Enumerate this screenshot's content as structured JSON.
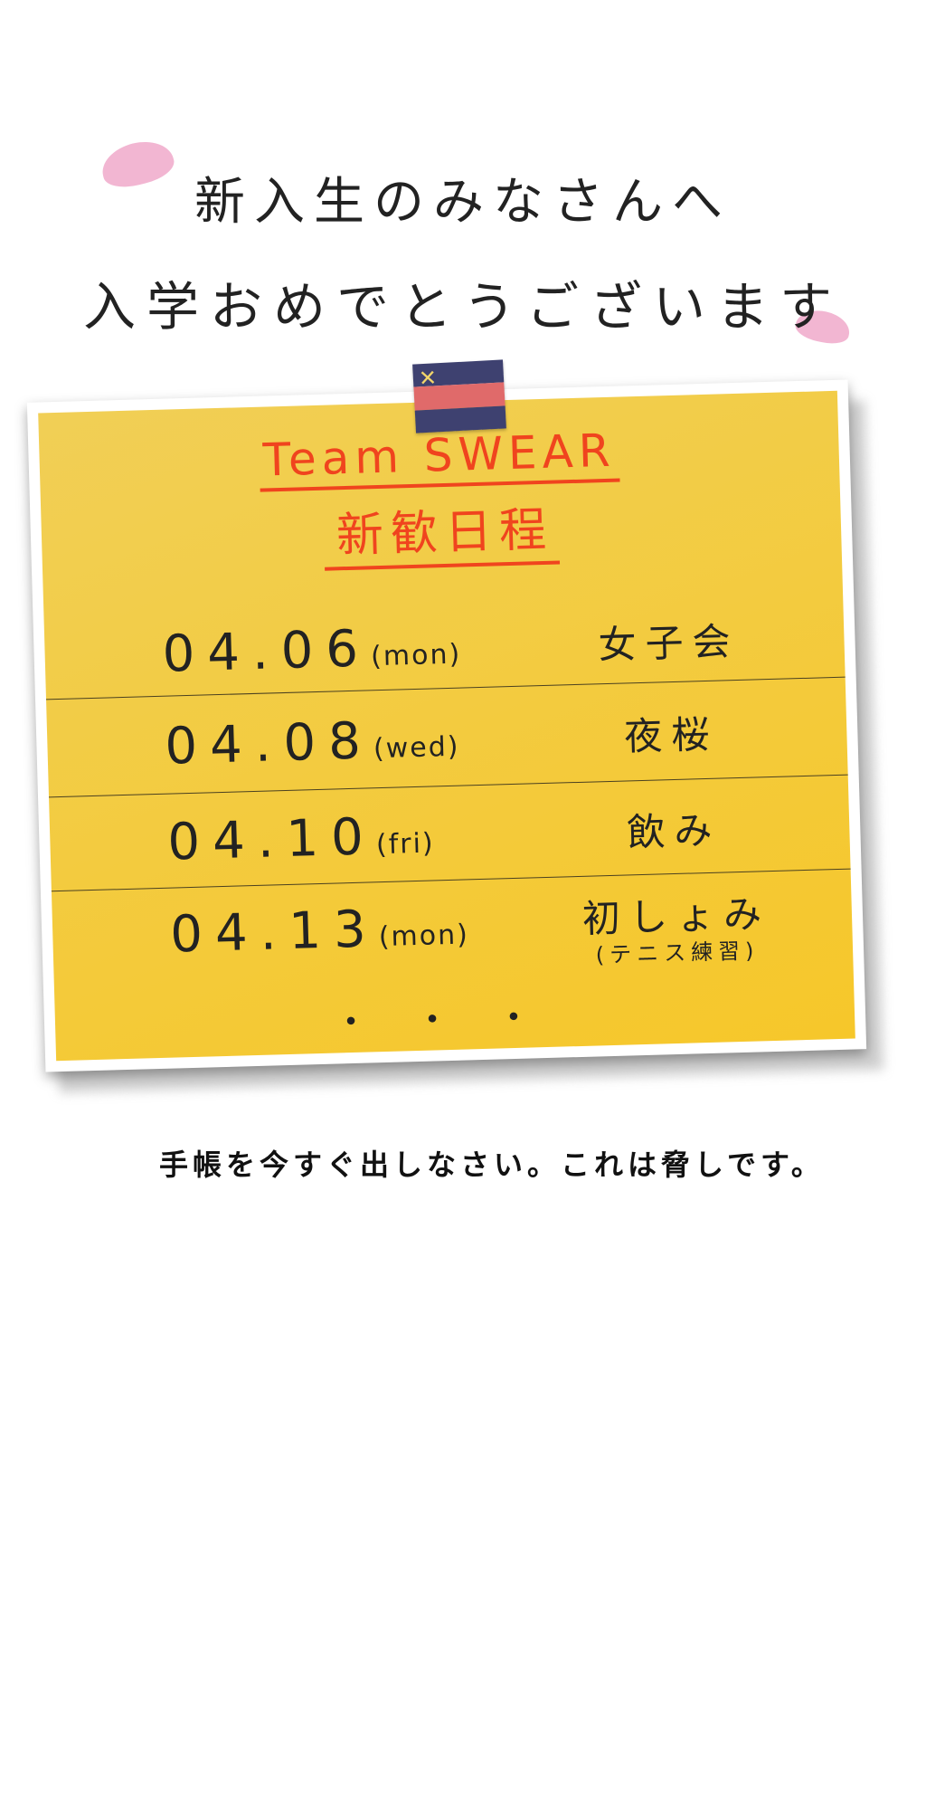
{
  "greeting": {
    "line1": "新入生のみなさんへ",
    "line2": "入学おめでとうございます"
  },
  "note": {
    "title_en": "Team SWEAR",
    "title_ja": "新歓日程",
    "schedule": [
      {
        "date": "04.06",
        "dow": "(mon)",
        "event": "女子会",
        "sub": ""
      },
      {
        "date": "04.08",
        "dow": "(wed)",
        "event": "夜桜",
        "sub": ""
      },
      {
        "date": "04.10",
        "dow": "(fri)",
        "event": "飲み",
        "sub": ""
      },
      {
        "date": "04.13",
        "dow": "(mon)",
        "event": "初しょみ",
        "sub": "(テニス練習)"
      }
    ],
    "ellipsis": "・・・"
  },
  "footer": {
    "text": "手帳を今すぐ出しなさい。これは脅しです。"
  },
  "colors": {
    "note_yellow": "#f3cb3f",
    "title_red": "#f0441e",
    "petal_pink": "#f2b6d2",
    "tape_navy": "#3e4170",
    "tape_red": "#e06a6a"
  },
  "icons": {
    "petal": "sakura-petal-icon",
    "tape": "striped-tape-icon"
  }
}
